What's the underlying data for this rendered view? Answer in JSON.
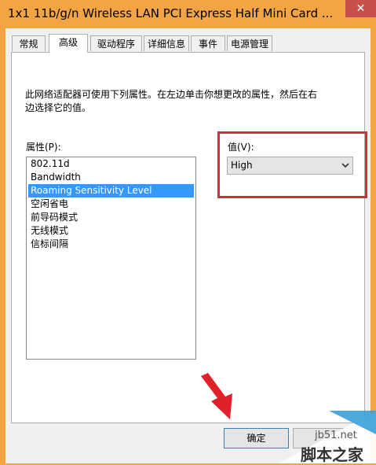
{
  "window": {
    "title": "1x1 11b/g/n Wireless LAN PCI Express Half Mini Card ...",
    "close_symbol": "✕"
  },
  "tabs": [
    {
      "label": "常规",
      "active": false
    },
    {
      "label": "高级",
      "active": true
    },
    {
      "label": "驱动程序",
      "active": false
    },
    {
      "label": "详细信息",
      "active": false
    },
    {
      "label": "事件",
      "active": false
    },
    {
      "label": "电源管理",
      "active": false
    }
  ],
  "advanced": {
    "description": "此网络适配器可使用下列属性。在左边单击你想更改的属性，然后在右边选择它的值。",
    "property_label": "属性(P):",
    "properties": [
      "802.11d",
      "Bandwidth",
      "Roaming Sensitivity Level",
      "空闲省电",
      "前导码模式",
      "无线模式",
      "信标间隔"
    ],
    "selected_property": "Roaming Sensitivity Level",
    "value_label": "值(V):",
    "value_selected": "High"
  },
  "buttons": {
    "ok_label": "确定"
  },
  "annotation": {
    "highlight_color": "#c6333a",
    "arrow_color": "#e0202a"
  },
  "watermark": {
    "site": "jb51.net",
    "brand": "脚本之家"
  },
  "colors": {
    "title_bar": "#f3a443",
    "selection": "#3399ff"
  }
}
